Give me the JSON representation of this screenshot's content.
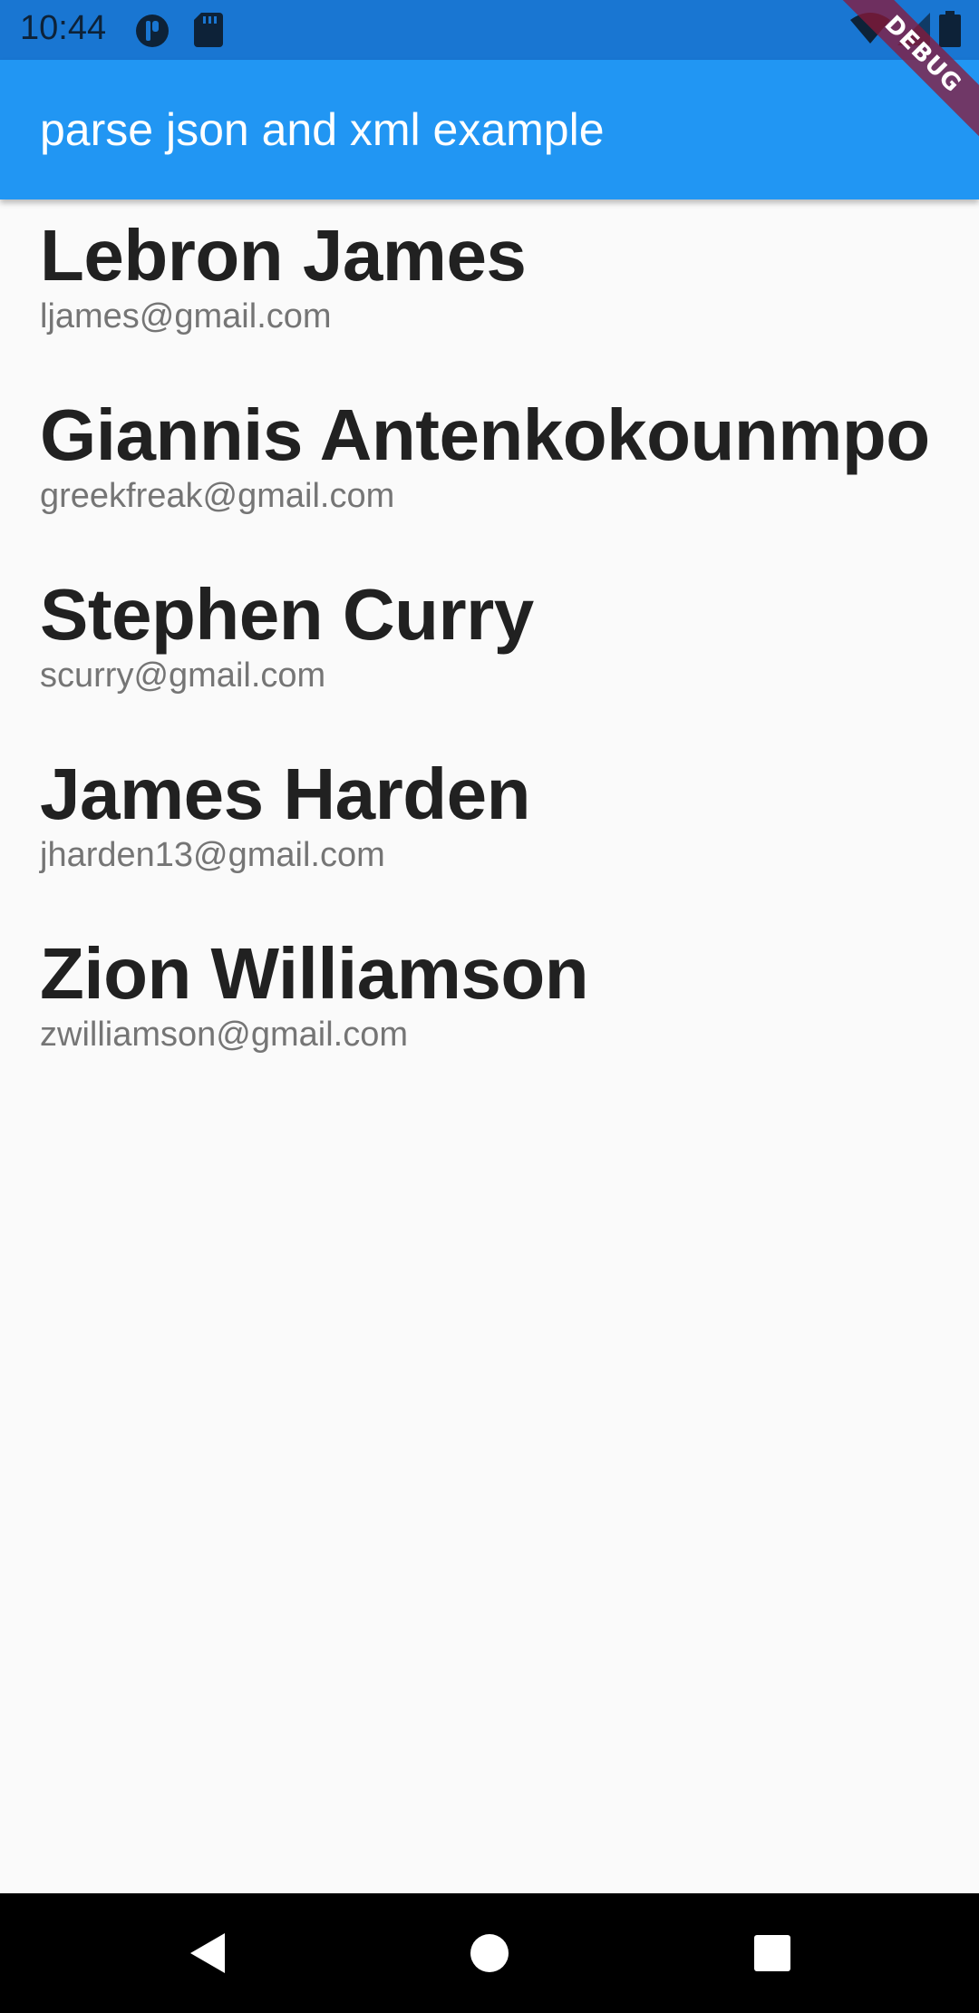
{
  "status_bar": {
    "time": "10:44",
    "icons": [
      "assistant-icon",
      "sd-card-icon",
      "wifi-icon",
      "signal-icon",
      "battery-icon"
    ]
  },
  "debug_banner": {
    "label": "DEBUG"
  },
  "app_bar": {
    "title": "parse json and xml example",
    "color": "#2196f3"
  },
  "list": {
    "items": [
      {
        "name": "Lebron James",
        "email": "ljames@gmail.com"
      },
      {
        "name": "Giannis Antenkokounmpo",
        "email": "greekfreak@gmail.com"
      },
      {
        "name": "Stephen Curry",
        "email": "scurry@gmail.com"
      },
      {
        "name": "James Harden",
        "email": "jharden13@gmail.com"
      },
      {
        "name": "Zion Williamson",
        "email": "zwilliamson@gmail.com"
      }
    ]
  },
  "nav_bar": {
    "icons": [
      "back-icon",
      "home-icon",
      "recents-icon"
    ]
  }
}
